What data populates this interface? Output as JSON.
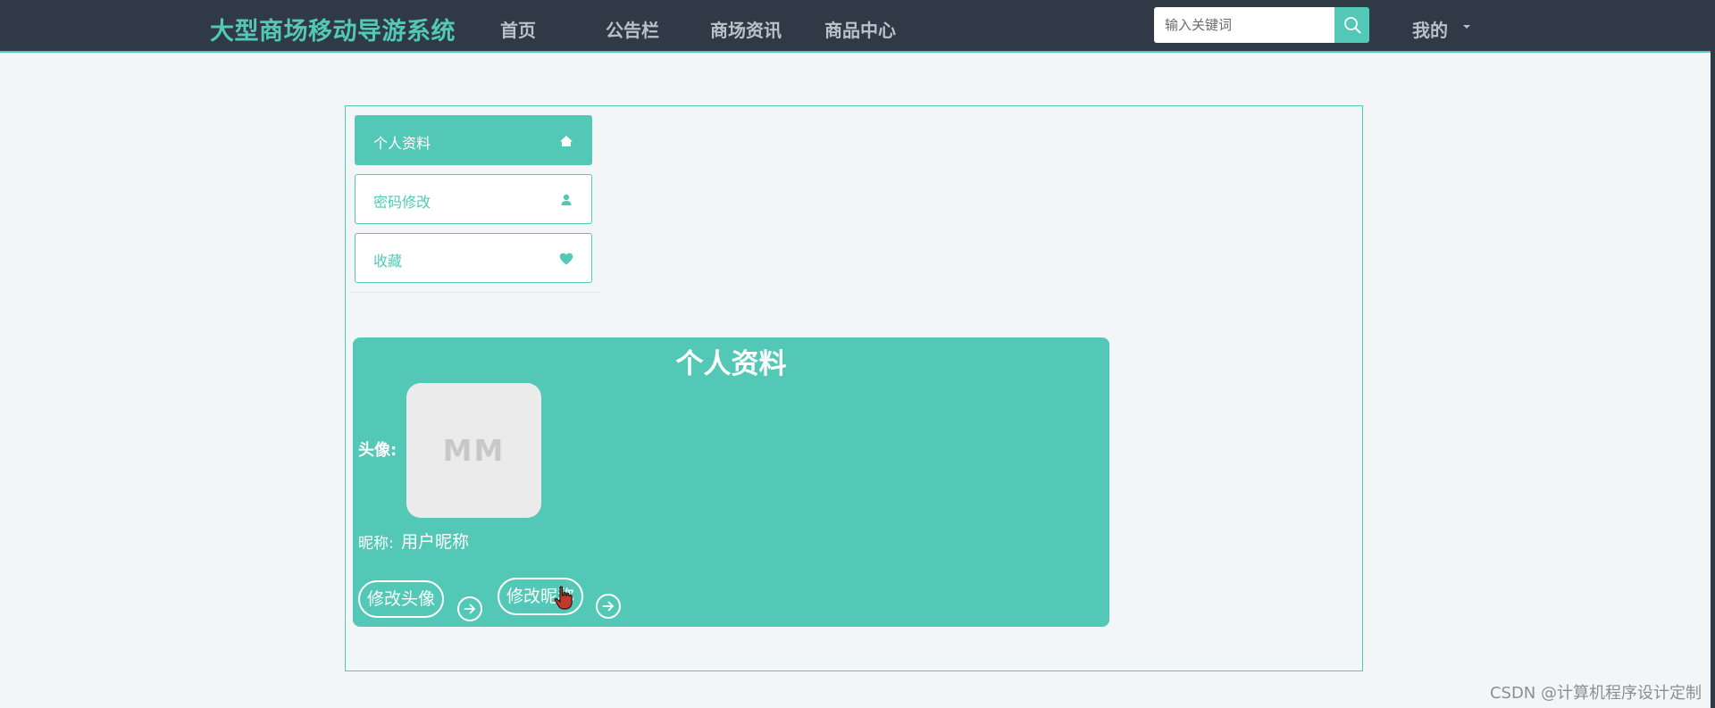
{
  "header": {
    "brand": "大型商场移动导游系统",
    "nav": [
      {
        "label": "首页"
      },
      {
        "label": "公告栏"
      },
      {
        "label": "商场资讯"
      },
      {
        "label": "商品中心"
      }
    ],
    "search": {
      "placeholder": "输入关键词",
      "value": ""
    },
    "user_menu": "我的"
  },
  "sidebar": {
    "items": [
      {
        "label": "个人资料",
        "icon": "home-icon",
        "active": true
      },
      {
        "label": "密码修改",
        "icon": "user-icon",
        "active": false
      },
      {
        "label": "收藏",
        "icon": "heart-icon",
        "active": false
      }
    ]
  },
  "profile": {
    "title": "个人资料",
    "avatar_label": "头像:",
    "avatar_text": "MM",
    "nickname_label": "昵称:",
    "nickname_value": "用户昵称",
    "change_avatar_button": "修改头像",
    "change_nickname_button": "修改昵称"
  },
  "watermark": "CSDN @计算机程序设计定制",
  "colors": {
    "accent": "#53c8b7",
    "nav_bg": "#2f3a46",
    "page_bg": "#f3f6f7"
  }
}
